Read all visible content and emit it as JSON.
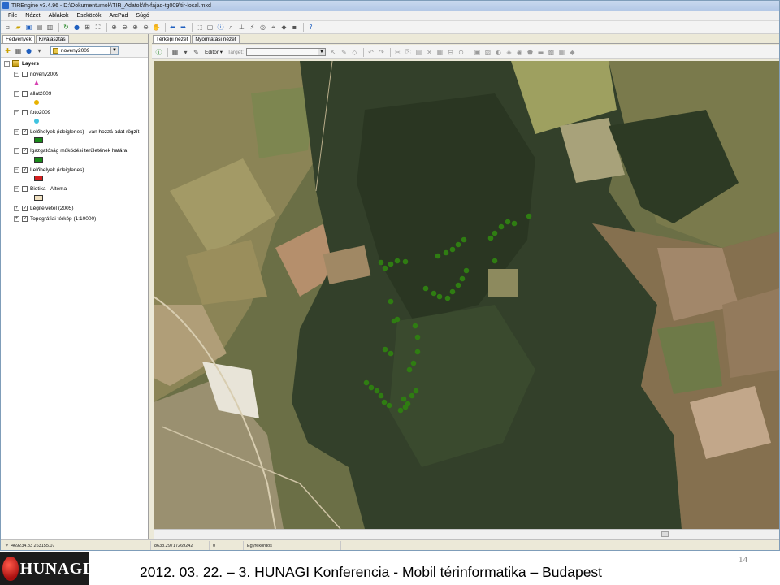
{
  "window": {
    "title": "TIREngine v3.4.96 - D:\\Dokumentumok\\TIR_Adatok\\fh-fajad-tg009\\tir-local.mxd"
  },
  "menu": [
    "File",
    "Nézet",
    "Ablakok",
    "Eszközök",
    "ArcPad",
    "Súgó"
  ],
  "left_panel": {
    "tabs": [
      "Fedvények",
      "Kiválasztás"
    ],
    "active_tab": "Fedvények",
    "layer_select": "noveny2009",
    "root_label": "Layers",
    "layers": [
      {
        "name": "noveny2009",
        "checked": false,
        "symbol": {
          "type": "triangle",
          "color": "#d63fb0"
        }
      },
      {
        "name": "allat2009",
        "checked": false,
        "symbol": {
          "type": "dot",
          "color": "#e8b200"
        }
      },
      {
        "name": "foto2009",
        "checked": false,
        "symbol": {
          "type": "dot",
          "color": "#3fc3e0"
        }
      },
      {
        "name": "Lelőhelyek (ideiglenes) - van hozzá adat rögzít",
        "checked": true,
        "symbol": {
          "type": "rect",
          "color": "#1a8a1a"
        }
      },
      {
        "name": "Igazgatóság működési területének határa",
        "checked": true,
        "symbol": {
          "type": "rect",
          "color": "#1a8a1a"
        }
      },
      {
        "name": "Lelőhelyek (ideiglenes)",
        "checked": true,
        "symbol": {
          "type": "rect",
          "color": "#d42020"
        }
      },
      {
        "name": "Biotika - Altéma",
        "checked": false,
        "symbol": {
          "type": "rect",
          "color": "#f0e0c0"
        }
      },
      {
        "name": "Légifelvétel (2005)",
        "checked": true,
        "symbol": null
      },
      {
        "name": "Topográfiai térkép (1:10000)",
        "checked": true,
        "symbol": null
      }
    ]
  },
  "right_panel": {
    "tabs": [
      "Térképi nézet",
      "Nyomtatási nézet"
    ],
    "active_tab": "Térképi nézet",
    "editor_label": "Editor ▾",
    "target_label": "Target:"
  },
  "statusbar": {
    "coords": "469234.83 263155.07",
    "scale_value": "8638.29717269242",
    "zero": "0",
    "mode": "Egyrekordos"
  },
  "slide_footer": {
    "logo_text": "HUNAGI",
    "caption": "2012. 03. 22. – 3. HUNAGI Konferencia - Mobil térinformatika – Budapest",
    "page_number": "14"
  },
  "map": {
    "marker_color": "#2f7d12",
    "description_layer": "aerial orthophoto with green site markers"
  }
}
